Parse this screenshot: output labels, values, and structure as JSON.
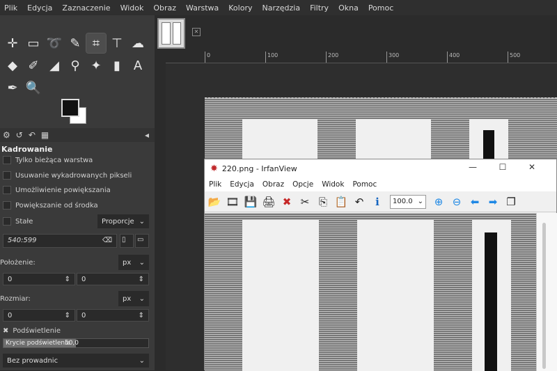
{
  "gimp": {
    "menu": [
      "Plik",
      "Edycja",
      "Zaznaczenie",
      "Widok",
      "Obraz",
      "Warstwa",
      "Kolory",
      "Narzędzia",
      "Filtry",
      "Okna",
      "Pomoc"
    ],
    "tools": [
      {
        "name": "move-tool-icon",
        "glyph": "✛"
      },
      {
        "name": "rect-select-icon",
        "glyph": "▭"
      },
      {
        "name": "lasso-icon",
        "glyph": "➰"
      },
      {
        "name": "fuzzy-select-icon",
        "glyph": "✎"
      },
      {
        "name": "crop-icon",
        "glyph": "⌗"
      },
      {
        "name": "align-icon",
        "glyph": "⊤"
      },
      {
        "name": "warp-icon",
        "glyph": "☁"
      },
      {
        "name": "bucket-fill-icon",
        "glyph": "◆"
      },
      {
        "name": "paintbrush-icon",
        "glyph": "✐"
      },
      {
        "name": "eraser-icon",
        "glyph": "◢"
      },
      {
        "name": "clone-icon",
        "glyph": "⚲"
      },
      {
        "name": "smudge-icon",
        "glyph": "✦"
      },
      {
        "name": "dodge-icon",
        "glyph": "▮"
      },
      {
        "name": "text-tool-icon",
        "glyph": "A"
      },
      {
        "name": "color-picker-icon",
        "glyph": "✒"
      },
      {
        "name": "zoom-tool-icon",
        "glyph": "🔍"
      }
    ],
    "options": {
      "title": "Kadrowanie",
      "checks": [
        "Tylko bieżąca warstwa",
        "Usuwanie wykadrowanych pikseli",
        "Umożliwienie powiększania",
        "Powiększanie od środka"
      ],
      "fixed_label": "Stałe",
      "fixed_mode": "Proporcje",
      "ratio": "540:599",
      "position_label": "Położenie:",
      "size_label": "Rozmiar:",
      "unit": "px",
      "pos_x": "0",
      "pos_y": "0",
      "size_w": "0",
      "size_h": "0",
      "highlight_label": "Podświetlenie",
      "opacity_label": "Krycie podświetlenia",
      "opacity_value": "50,0",
      "opacity_fraction": 0.5,
      "guides": "Bez prowadnic"
    },
    "ruler_labels": [
      "0",
      "100",
      "200",
      "300",
      "400",
      "500"
    ]
  },
  "irfanview": {
    "title": "220.png - IrfanView",
    "menu": [
      "Plik",
      "Edycja",
      "Obraz",
      "Opcje",
      "Widok",
      "Pomoc"
    ],
    "zoom": "100.0",
    "window_buttons": {
      "minimize": "—",
      "maximize": "☐",
      "close": "✕"
    },
    "toolbar": [
      {
        "name": "open-icon",
        "glyph": "📂"
      },
      {
        "name": "slideshow-icon",
        "glyph": "🎞"
      },
      {
        "name": "save-icon",
        "glyph": "💾"
      },
      {
        "name": "print-icon",
        "glyph": "🖨"
      },
      {
        "name": "delete-icon",
        "glyph": "✖"
      },
      {
        "name": "cut-icon",
        "glyph": "✂"
      },
      {
        "name": "copy-icon",
        "glyph": "⎘"
      },
      {
        "name": "paste-icon",
        "glyph": "📋"
      },
      {
        "name": "undo-icon",
        "glyph": "↶"
      },
      {
        "name": "info-icon",
        "glyph": "ℹ"
      }
    ],
    "toolbar_after": [
      {
        "name": "zoom-in-icon",
        "glyph": "⊕"
      },
      {
        "name": "zoom-out-icon",
        "glyph": "⊖"
      },
      {
        "name": "previous-icon",
        "glyph": "⬅"
      },
      {
        "name": "next-icon",
        "glyph": "➡"
      },
      {
        "name": "thumbnails-icon",
        "glyph": "❐"
      }
    ]
  }
}
